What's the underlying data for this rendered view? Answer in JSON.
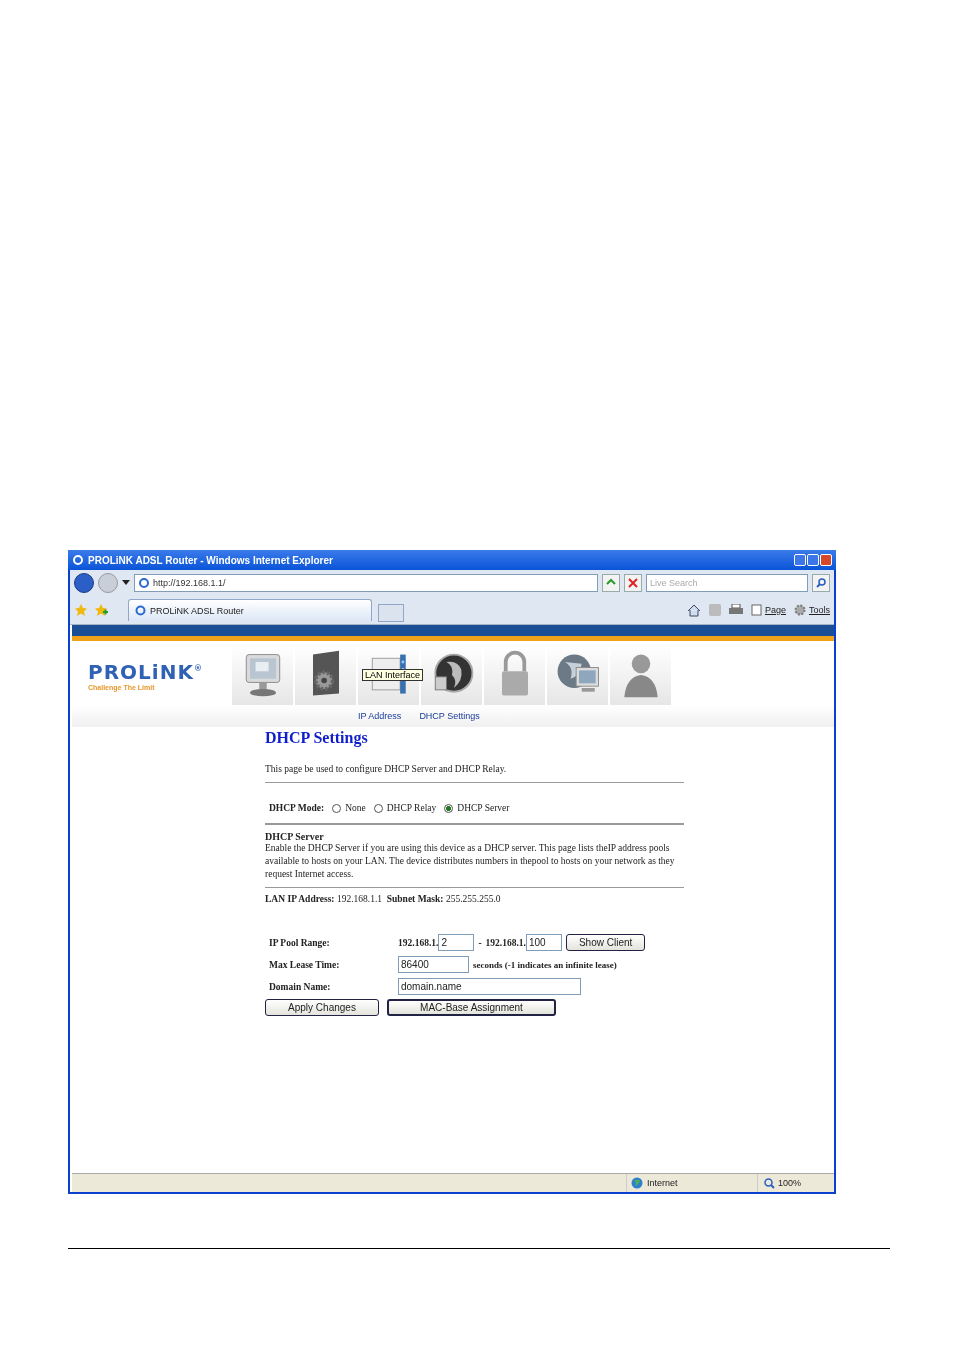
{
  "window": {
    "title": "PROLiNK ADSL Router - Windows Internet Explorer"
  },
  "address_bar": {
    "url": "http://192.168.1.1/"
  },
  "search": {
    "placeholder": "Live Search"
  },
  "tabs": [
    {
      "label": "PROLiNK ADSL Router",
      "selected": true
    }
  ],
  "command_bar": [
    "Page",
    "Tools"
  ],
  "router": {
    "logo": "PROLiNK",
    "logo_mark": "®",
    "tagline": "Challenge The Limit",
    "tooltip": "LAN Interface",
    "submenu": [
      "IP Address",
      "DHCP Settings"
    ]
  },
  "page": {
    "title": "DHCP Settings",
    "intro": "This page be used to configure DHCP Server and DHCP Relay.",
    "mode_label": "DHCP Mode:",
    "mode_options": [
      {
        "label": "None",
        "selected": false
      },
      {
        "label": "DHCP Relay",
        "selected": false
      },
      {
        "label": "DHCP Server",
        "selected": true
      }
    ],
    "section_title": "DHCP Server",
    "section_text": "Enable the DHCP Server if you are using this device as a DHCP server. This page lists theIP address pools available to hosts on your LAN. The device distributes numbers in thepool to hosts on your network as they request Internet access.",
    "lan_ip_label": "LAN IP Address:",
    "lan_ip": "192.168.1.1",
    "subnet_label": "Subnet Mask:",
    "subnet": "255.255.255.0",
    "pool_label": "IP Pool Range:",
    "pool_prefix_start": "192.168.1.",
    "pool_start": "2",
    "pool_dash": "-",
    "pool_prefix_end": "192.168.1.",
    "pool_end": "100",
    "show_client": "Show Client",
    "lease_label": "Max Lease Time:",
    "lease": "86400",
    "lease_note": "seconds (-1 indicates an infinite lease)",
    "domain_label": "Domain Name:",
    "domain": "domain.name",
    "buttons": [
      "Apply Changes",
      "MAC-Base Assignment"
    ]
  },
  "status_bar": {
    "zone": "Internet",
    "zoom": "100%"
  }
}
